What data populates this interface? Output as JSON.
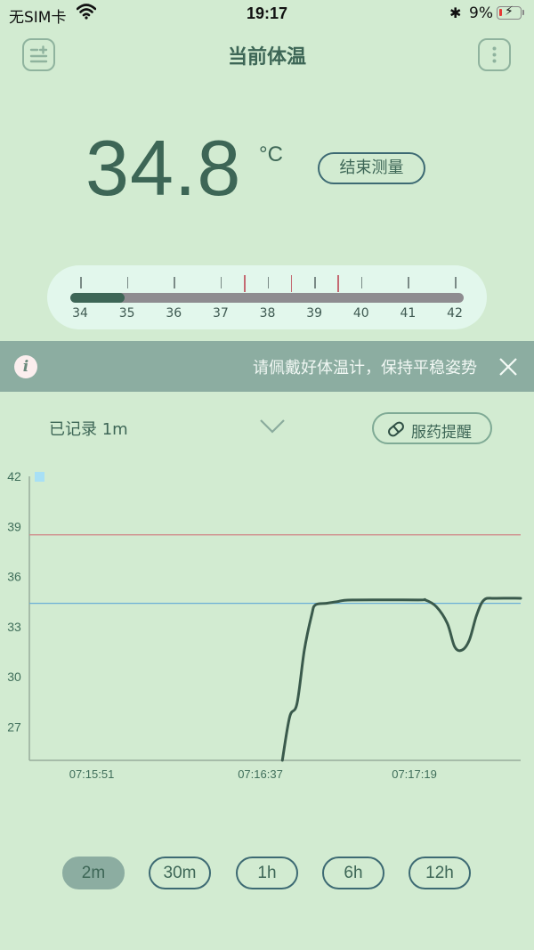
{
  "status_bar": {
    "carrier": "无SIM卡",
    "time": "19:17",
    "battery_percent": "9%",
    "icons": [
      "wifi-icon",
      "bluetooth-icon",
      "battery-charging-icon"
    ]
  },
  "nav": {
    "title": "当前体温",
    "left_icon": "list-add-icon",
    "right_icon": "more-vertical-icon"
  },
  "reading": {
    "value": "34.8",
    "unit": "°C",
    "stop_button": "结束测量"
  },
  "gauge": {
    "labels": [
      "34",
      "35",
      "36",
      "37",
      "38",
      "39",
      "40",
      "41",
      "42"
    ],
    "min": 34,
    "max": 42,
    "current": 34.8,
    "alert_marks": [
      37.5,
      38.5,
      39.5
    ],
    "colors": {
      "fill": "#3d6656",
      "track": "#8e8c90",
      "alert": "#c46a72"
    }
  },
  "banner": {
    "icon": "info-icon",
    "message": "请佩戴好体温计，保持平稳姿势",
    "close_icon": "close-icon"
  },
  "record": {
    "duration_label": "已记录 1m",
    "expand_icon": "chevron-down-icon",
    "medication_button": "服药提醒",
    "medication_icon": "pill-icon"
  },
  "chart_data": {
    "type": "line",
    "title": "",
    "xlabel": "",
    "ylabel": "",
    "ylim": [
      25,
      42
    ],
    "y_ticks": [
      42,
      39,
      36,
      33,
      30,
      27
    ],
    "x_unit": "seconds since 07:15:51",
    "xlim": [
      -17,
      117
    ],
    "x_ticks": [
      {
        "value": 0,
        "label": "07:15:51"
      },
      {
        "value": 46,
        "label": "07:16:37"
      },
      {
        "value": 88,
        "label": "07:17:19"
      }
    ],
    "grid": false,
    "legend": {
      "position": "top-left",
      "marker_color": "#a8e0f5"
    },
    "reference_lines": [
      {
        "name": "high-threshold",
        "value": 38.5,
        "color": "#d08a8a"
      },
      {
        "name": "low-threshold",
        "value": 34.4,
        "color": "#6aaed6"
      }
    ],
    "series": [
      {
        "name": "temperature",
        "color": "#3a5a4c",
        "x": [
          52,
          54,
          56,
          58,
          60,
          61,
          64,
          67,
          71,
          89,
          91,
          94,
          97,
          99,
          101,
          103,
          105,
          107,
          110,
          117
        ],
        "y": [
          25.0,
          27.6,
          28.4,
          31.6,
          33.7,
          34.3,
          34.4,
          34.5,
          34.6,
          34.6,
          34.6,
          34.2,
          33.2,
          31.8,
          31.6,
          32.2,
          33.7,
          34.6,
          34.7,
          34.7
        ]
      }
    ]
  },
  "ranges": {
    "selected": "2m",
    "options": [
      "2m",
      "30m",
      "1h",
      "6h",
      "12h"
    ]
  }
}
